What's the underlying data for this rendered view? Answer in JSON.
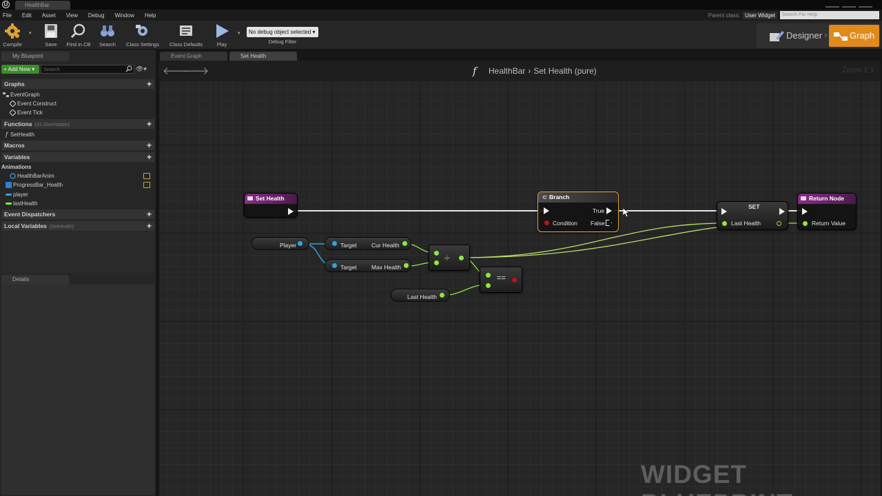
{
  "window": {
    "tab_title": "HealthBar"
  },
  "menu": [
    "File",
    "Edit",
    "Asset",
    "View",
    "Debug",
    "Window",
    "Help"
  ],
  "parent_class": {
    "label": "Parent class:",
    "value": "User Widget",
    "search_placeholder": "Search For Help"
  },
  "toolbar": {
    "compile": "Compile",
    "save": "Save",
    "find_in_cb": "Find in CB",
    "search": "Search",
    "class_settings": "Class Settings",
    "class_defaults": "Class Defaults",
    "play": "Play",
    "debug_select": "No debug object selected ▾",
    "debug_filter": "Debug Filter"
  },
  "modes": {
    "designer": "Designer",
    "graph": "Graph"
  },
  "left_panel": {
    "tab": "My Blueprint",
    "add_new": "+ Add New ▾",
    "search_placeholder": "Search",
    "sections": {
      "graphs": "Graphs",
      "functions": "Functions",
      "functions_sub": "(31 Overridable)",
      "macros": "Macros",
      "variables": "Variables",
      "animations": "Animations",
      "dispatchers": "Event Dispatchers",
      "locals": "Local Variables",
      "locals_sub": "(SetHealth)"
    },
    "graph_items": [
      "EventGraph",
      "Event Construct",
      "Event Tick"
    ],
    "function_items": [
      "SetHealth"
    ],
    "animation_items": [
      "HealthBarAnim",
      "ProgressBar_Health",
      "player",
      "lastHealth"
    ],
    "details_tab": "Details"
  },
  "graph_tabs": [
    "Event Graph",
    "Set Health"
  ],
  "breadcrumb": {
    "parent": "HealthBar",
    "current": "Set Health (pure)"
  },
  "zoom": "Zoom 1:1",
  "nodes": {
    "entry": "Set Health",
    "branch": "Branch",
    "branch_true": "True",
    "branch_false": "False",
    "branch_condition": "Condition",
    "set": "SET",
    "set_pin": "Last Health",
    "return": "Return Node",
    "return_pin": "Return Value",
    "player": "Player",
    "target1": "Target",
    "cur_health": "Cur Health",
    "target2": "Target",
    "max_health": "Max Health",
    "last_health": "Last Health",
    "divide_op": "÷",
    "equal_op": "=="
  },
  "watermark": "WIDGET BLUEPRINT",
  "colors": {
    "accent": "#e08a1c",
    "function_node": "#8a2c8a",
    "float_pin": "#8fe83a",
    "object_pin": "#2fa4e6"
  }
}
